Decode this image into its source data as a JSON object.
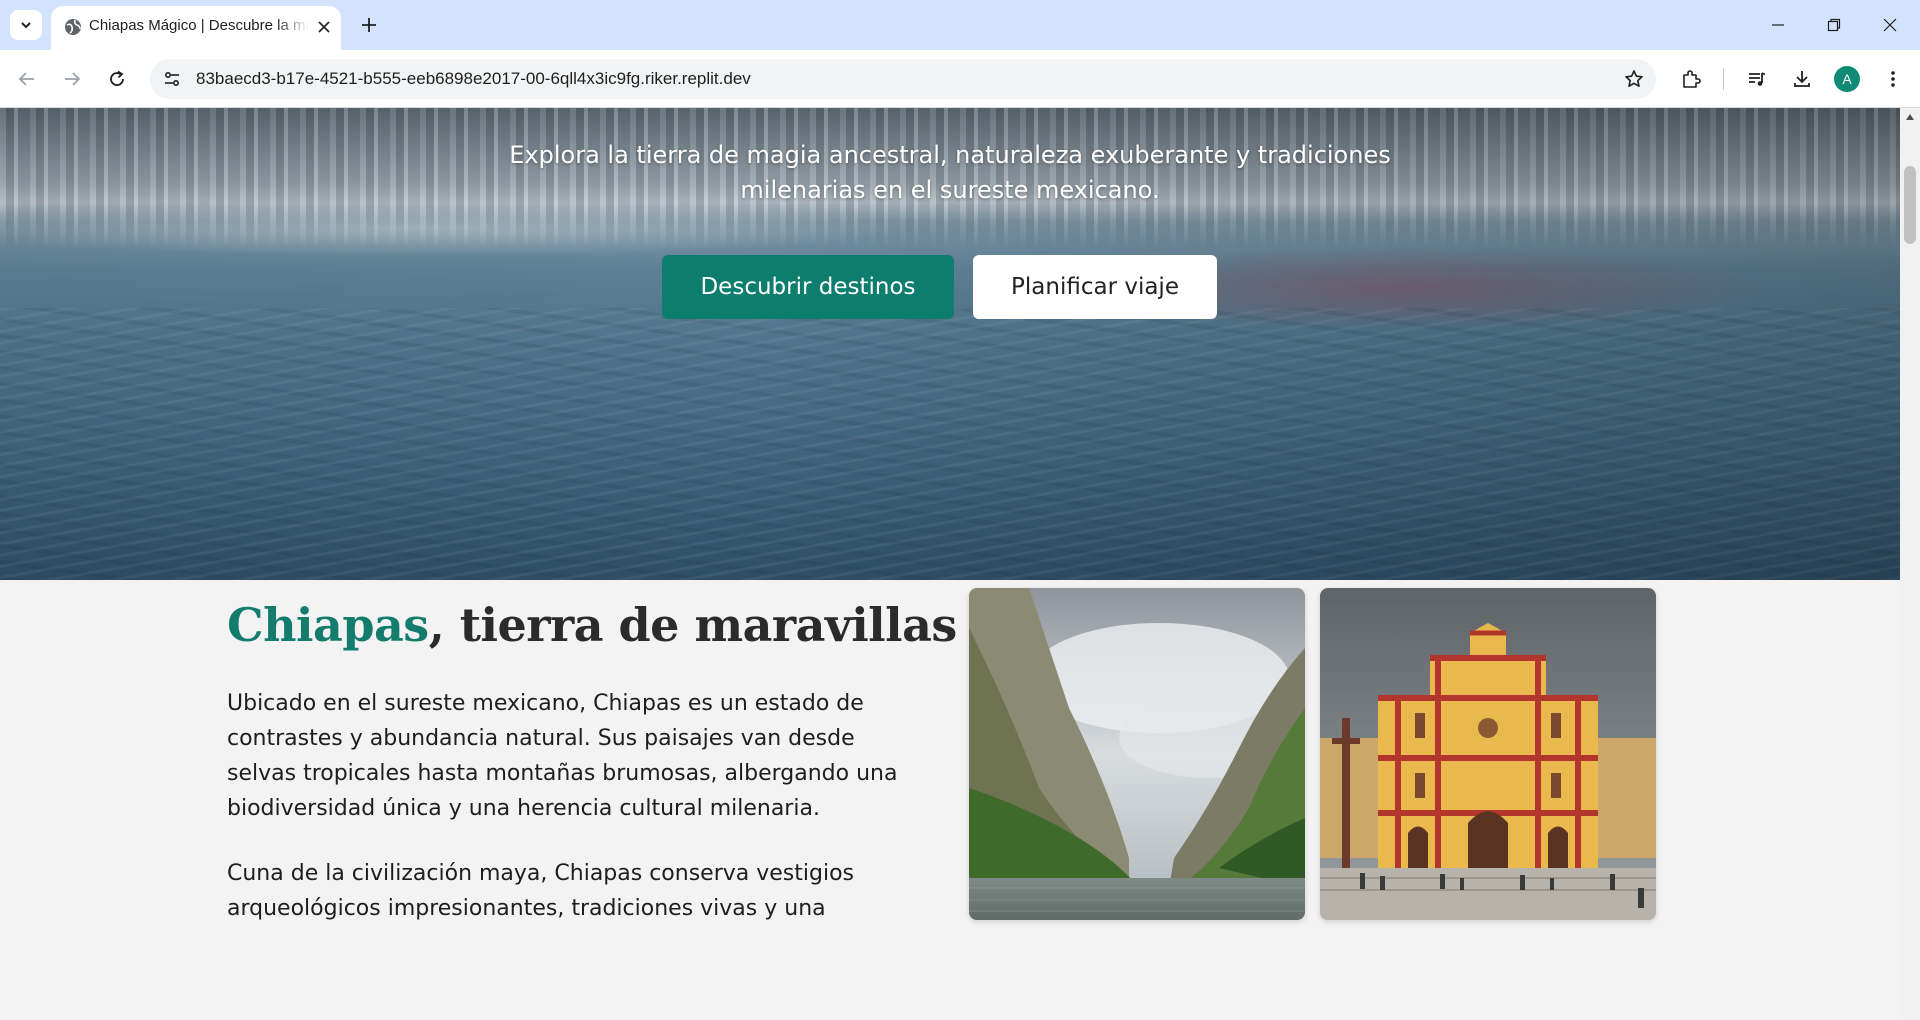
{
  "browser": {
    "tab_title": "Chiapas Mágico | Descubre la magia de Chiapas",
    "url": "83baecd3-b17e-4521-b555-eeb6898e2017-00-6qll4x3ic9fg.riker.replit.dev",
    "profile_initial": "A"
  },
  "hero": {
    "subtitle": "Explora la tierra de magia ancestral, naturaleza exuberante y tradiciones milenarias en el sureste mexicano.",
    "primary_button": "Descubrir destinos",
    "secondary_button": "Planificar viaje"
  },
  "about": {
    "title_accent": "Chiapas",
    "title_rest": ", tierra de maravillas",
    "paragraph1": "Ubicado en el sureste mexicano, Chiapas es un estado de contrastes y abundancia natural. Sus paisajes van desde selvas tropicales hasta montañas brumosas, albergando una biodiversidad única y una herencia cultural milenaria.",
    "paragraph2": "Cuna de la civilización maya, Chiapas conserva vestigios arqueológicos impresionantes, tradiciones vivas y una"
  },
  "colors": {
    "accent": "#0d7e6e",
    "tabbar": "#d3e3fd",
    "page_bg": "#f3f3f3"
  },
  "icons": [
    "tab-search-icon",
    "globe-icon",
    "close-icon",
    "plus-icon",
    "minimize-icon",
    "restore-icon",
    "back-arrow-icon",
    "forward-arrow-icon",
    "reload-icon",
    "site-info-icon",
    "star-icon",
    "extensions-icon",
    "media-controls-icon",
    "download-icon",
    "more-vert-icon"
  ]
}
